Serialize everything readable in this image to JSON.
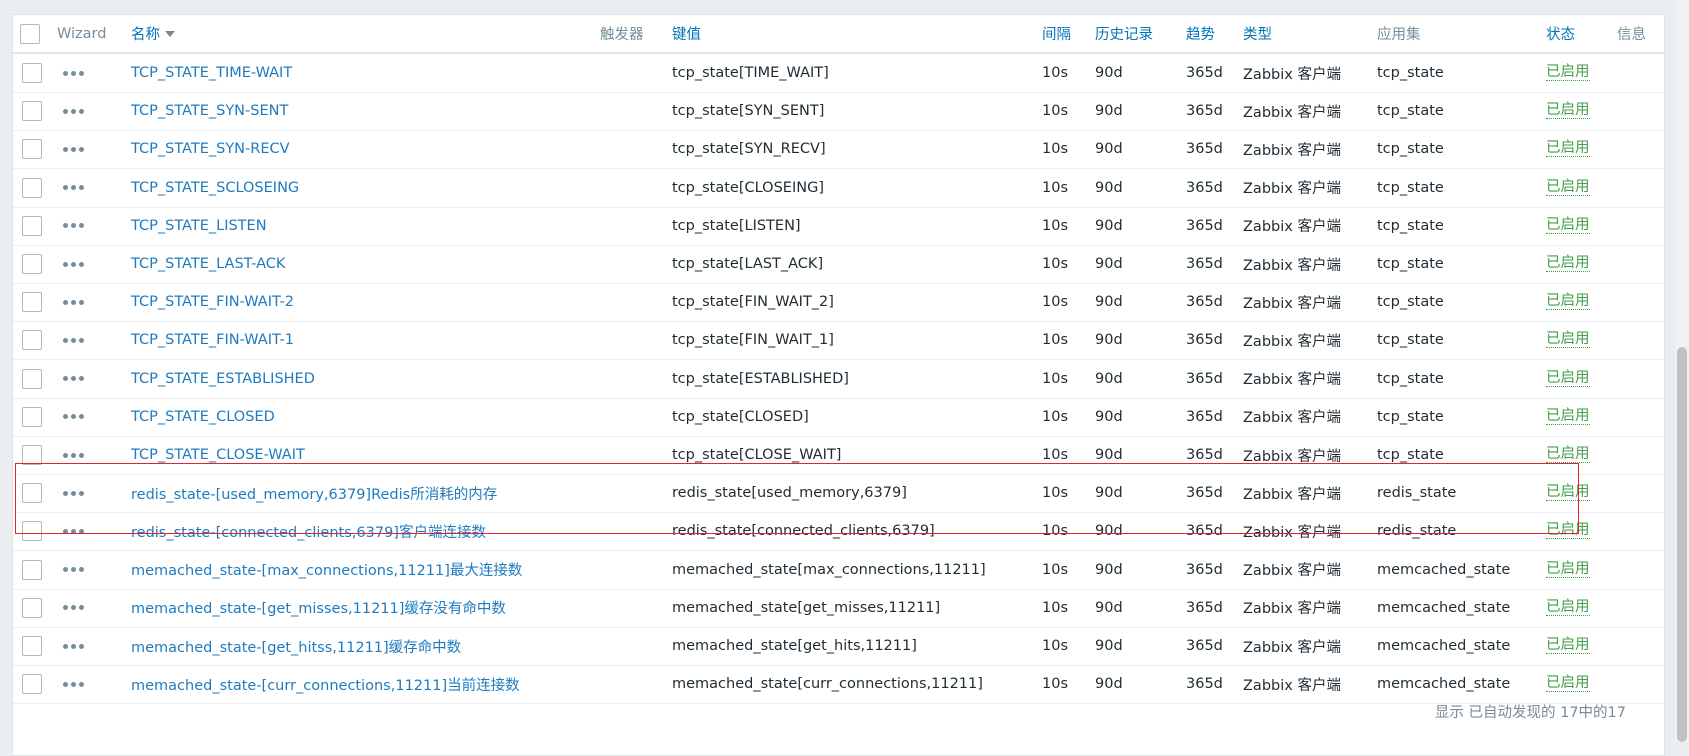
{
  "header": {
    "wizard": "Wizard",
    "name": "名称",
    "triggers": "触发器",
    "key": "键值",
    "interval": "间隔",
    "history": "历史记录",
    "trends": "趋势",
    "type": "类型",
    "applications": "应用集",
    "status": "状态",
    "info": "信息"
  },
  "rows": [
    {
      "name": "TCP_STATE_TIME-WAIT",
      "key": "tcp_state[TIME_WAIT]",
      "interval": "10s",
      "history": "90d",
      "trends": "365d",
      "type": "Zabbix 客户端",
      "application": "tcp_state",
      "status": "已启用"
    },
    {
      "name": "TCP_STATE_SYN-SENT",
      "key": "tcp_state[SYN_SENT]",
      "interval": "10s",
      "history": "90d",
      "trends": "365d",
      "type": "Zabbix 客户端",
      "application": "tcp_state",
      "status": "已启用"
    },
    {
      "name": "TCP_STATE_SYN-RECV",
      "key": "tcp_state[SYN_RECV]",
      "interval": "10s",
      "history": "90d",
      "trends": "365d",
      "type": "Zabbix 客户端",
      "application": "tcp_state",
      "status": "已启用"
    },
    {
      "name": "TCP_STATE_SCLOSEING",
      "key": "tcp_state[CLOSEING]",
      "interval": "10s",
      "history": "90d",
      "trends": "365d",
      "type": "Zabbix 客户端",
      "application": "tcp_state",
      "status": "已启用"
    },
    {
      "name": "TCP_STATE_LISTEN",
      "key": "tcp_state[LISTEN]",
      "interval": "10s",
      "history": "90d",
      "trends": "365d",
      "type": "Zabbix 客户端",
      "application": "tcp_state",
      "status": "已启用"
    },
    {
      "name": "TCP_STATE_LAST-ACK",
      "key": "tcp_state[LAST_ACK]",
      "interval": "10s",
      "history": "90d",
      "trends": "365d",
      "type": "Zabbix 客户端",
      "application": "tcp_state",
      "status": "已启用"
    },
    {
      "name": "TCP_STATE_FIN-WAIT-2",
      "key": "tcp_state[FIN_WAIT_2]",
      "interval": "10s",
      "history": "90d",
      "trends": "365d",
      "type": "Zabbix 客户端",
      "application": "tcp_state",
      "status": "已启用"
    },
    {
      "name": "TCP_STATE_FIN-WAIT-1",
      "key": "tcp_state[FIN_WAIT_1]",
      "interval": "10s",
      "history": "90d",
      "trends": "365d",
      "type": "Zabbix 客户端",
      "application": "tcp_state",
      "status": "已启用"
    },
    {
      "name": "TCP_STATE_ESTABLISHED",
      "key": "tcp_state[ESTABLISHED]",
      "interval": "10s",
      "history": "90d",
      "trends": "365d",
      "type": "Zabbix 客户端",
      "application": "tcp_state",
      "status": "已启用"
    },
    {
      "name": "TCP_STATE_CLOSED",
      "key": "tcp_state[CLOSED]",
      "interval": "10s",
      "history": "90d",
      "trends": "365d",
      "type": "Zabbix 客户端",
      "application": "tcp_state",
      "status": "已启用"
    },
    {
      "name": "TCP_STATE_CLOSE-WAIT",
      "key": "tcp_state[CLOSE_WAIT]",
      "interval": "10s",
      "history": "90d",
      "trends": "365d",
      "type": "Zabbix 客户端",
      "application": "tcp_state",
      "status": "已启用"
    },
    {
      "name": "redis_state-[used_memory,6379]Redis所消耗的内存",
      "key": "redis_state[used_memory,6379]",
      "interval": "10s",
      "history": "90d",
      "trends": "365d",
      "type": "Zabbix 客户端",
      "application": "redis_state",
      "status": "已启用"
    },
    {
      "name": "redis_state-[connected_clients,6379]客户端连接数",
      "key": "redis_state[connected_clients,6379]",
      "interval": "10s",
      "history": "90d",
      "trends": "365d",
      "type": "Zabbix 客户端",
      "application": "redis_state",
      "status": "已启用"
    },
    {
      "name": "memached_state-[max_connections,11211]最大连接数",
      "key": "memached_state[max_connections,11211]",
      "interval": "10s",
      "history": "90d",
      "trends": "365d",
      "type": "Zabbix 客户端",
      "application": "memcached_state",
      "status": "已启用"
    },
    {
      "name": "memached_state-[get_misses,11211]缓存没有命中数",
      "key": "memached_state[get_misses,11211]",
      "interval": "10s",
      "history": "90d",
      "trends": "365d",
      "type": "Zabbix 客户端",
      "application": "memcached_state",
      "status": "已启用"
    },
    {
      "name": "memached_state-[get_hitss,11211]缓存命中数",
      "key": "memached_state[get_hits,11211]",
      "interval": "10s",
      "history": "90d",
      "trends": "365d",
      "type": "Zabbix 客户端",
      "application": "memcached_state",
      "status": "已启用"
    },
    {
      "name": "memached_state-[curr_connections,11211]当前连接数",
      "key": "memached_state[curr_connections,11211]",
      "interval": "10s",
      "history": "90d",
      "trends": "365d",
      "type": "Zabbix 客户端",
      "application": "memcached_state",
      "status": "已启用"
    }
  ],
  "footer": {
    "summary": "显示 已自动发现的 17中的17"
  },
  "colors": {
    "link": "#1f7bc0",
    "enabled": "#429e47",
    "highlight_border": "#e0262b",
    "header_text": "#768d99"
  },
  "icons": {
    "row_menu": "ellipsis-icon",
    "sort": "sort-desc-arrow-icon"
  }
}
